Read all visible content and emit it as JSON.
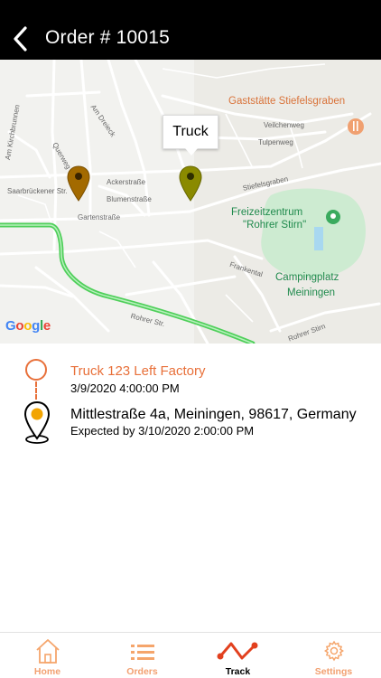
{
  "header": {
    "title": "Order # 10015",
    "back_icon": "chevron-left-icon"
  },
  "map": {
    "callout": "Truck",
    "attribution": "Google",
    "labels": {
      "gaststaette": "Gaststätte Stiefelsgraben",
      "freizeit_1": "Freizeitzentrum",
      "freizeit_2": "\"Rohrer Stirn\"",
      "camping_1": "Campingplatz",
      "camping_2": "Meiningen",
      "ackerstrasse": "Ackerstraße",
      "blumenstrasse": "Blumenstraße",
      "gartenstrasse": "Gartenstraße",
      "saarbruecker": "Saarbrückener Str.",
      "rohrer_str": "Rohrer Str.",
      "veilchenweg": "Veilchenweg",
      "tulpenweg": "Tulpenweg",
      "stiefelsgraben": "Stiefelsgraben",
      "frankental": "Frankental",
      "am_dreieck": "Am Dreieck",
      "am_kirchbrunnen": "Am Kirchbrunnen",
      "rohrer_stirn": "Rohrer Stirn",
      "querweg": "Querweg"
    },
    "colors": {
      "route": "#4fcf5a",
      "pin_origin": "#a36a00",
      "pin_truck": "#8a8a00",
      "park": "#cdebd1",
      "accent": "#e8703a"
    }
  },
  "tracking": {
    "origin": {
      "title": "Truck 123 Left Factory",
      "time": "3/9/2020 4:00:00 PM"
    },
    "destination": {
      "address": "Mittlestraße 4a, Meiningen, 98617, Germany",
      "expected": "Expected by 3/10/2020 2:00:00 PM"
    }
  },
  "tabs": [
    {
      "label": "Home",
      "icon": "home-icon",
      "active": false
    },
    {
      "label": "Orders",
      "icon": "list-icon",
      "active": false
    },
    {
      "label": "Track",
      "icon": "track-line-icon",
      "active": true
    },
    {
      "label": "Settings",
      "icon": "gear-icon",
      "active": false
    }
  ]
}
